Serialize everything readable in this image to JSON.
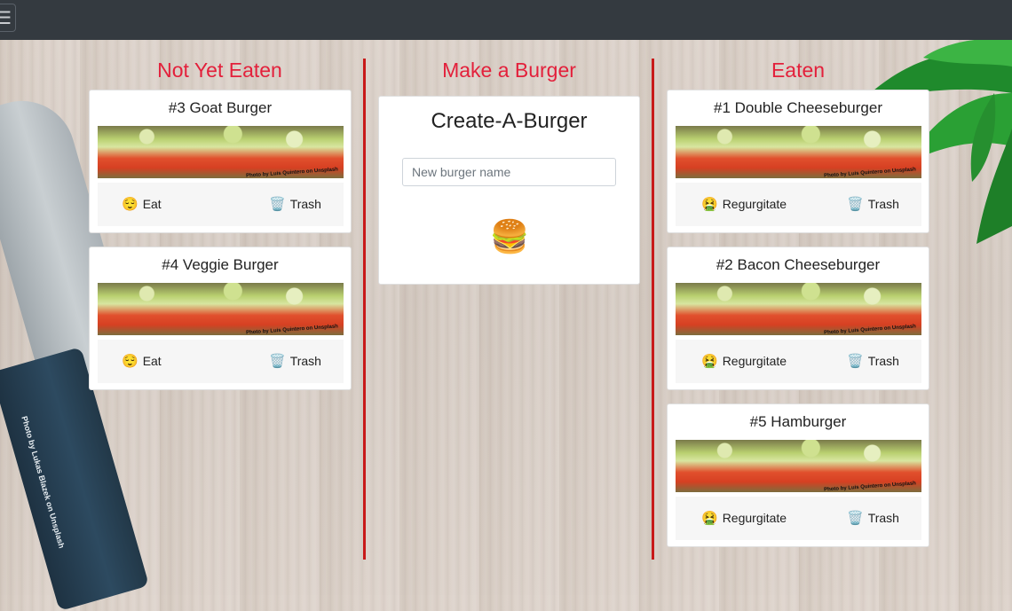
{
  "columns": {
    "not_eaten_title": "Not Yet Eaten",
    "make_title": "Make a Burger",
    "eaten_title": "Eaten"
  },
  "create": {
    "title": "Create-A-Burger",
    "input_placeholder": "New burger name",
    "submit_icon": "🍔"
  },
  "image_credit": "Photo by Luis Quintero on Unsplash",
  "background_credit": "Photo by Lukas Blazek on Unsplash",
  "not_eaten": [
    {
      "name": "#3 Goat Burger",
      "action_icon": "😌",
      "action": "Eat",
      "trash_icon": "🗑️",
      "trash": "Trash"
    },
    {
      "name": "#4 Veggie Burger",
      "action_icon": "😌",
      "action": "Eat",
      "trash_icon": "🗑️",
      "trash": "Trash"
    }
  ],
  "eaten": [
    {
      "name": "#1 Double Cheeseburger",
      "action_icon": "🤮",
      "action": "Regurgitate",
      "trash_icon": "🗑️",
      "trash": "Trash"
    },
    {
      "name": "#2 Bacon Cheeseburger",
      "action_icon": "🤮",
      "action": "Regurgitate",
      "trash_icon": "🗑️",
      "trash": "Trash"
    },
    {
      "name": "#5 Hamburger",
      "action_icon": "🤮",
      "action": "Regurgitate",
      "trash_icon": "🗑️",
      "trash": "Trash"
    }
  ],
  "nav": {
    "toggle_icon": "☰"
  },
  "colors": {
    "heading": "#e3203b",
    "divider": "#c81a1a",
    "navbar": "#343a40"
  }
}
